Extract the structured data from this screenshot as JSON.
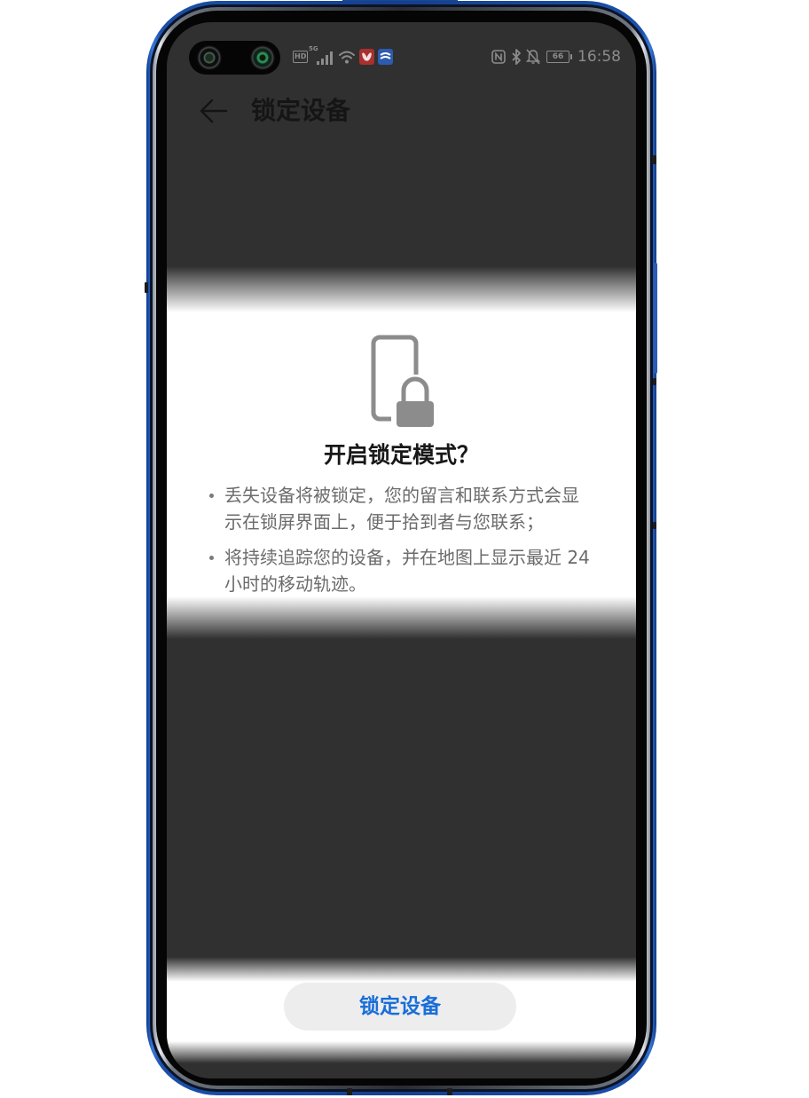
{
  "status_bar": {
    "hd_label": "HD",
    "network_label": "5G",
    "battery_level": "66",
    "time": "16:58",
    "left_icons": [
      "front-camera-icon",
      "depth-camera-icon",
      "signal-icon",
      "wifi-icon",
      "huawei-app-icon",
      "app-notification-icon"
    ],
    "right_icons": [
      "nfc-icon",
      "bluetooth-icon",
      "bell-off-icon",
      "battery-icon"
    ]
  },
  "app_bar": {
    "back_icon": "back-arrow-icon",
    "title": "锁定设备"
  },
  "dialog": {
    "icon": "phone-lock-icon",
    "title": "开启锁定模式？",
    "bullets": [
      "丢失设备将被锁定，您的留言和联系方式会显示在锁屏界面上，便于拾到者与您联系；",
      "将持续追踪您的设备，并在地图上显示最近 24 小时的移动轨迹。"
    ]
  },
  "action": {
    "lock_button_label": "锁定设备"
  },
  "colors": {
    "frame_blue": "#1e4fa6",
    "screen_dim": "#303030",
    "accent_blue": "#1a6ed8",
    "icon_gray": "#8c8c8c",
    "text_secondary": "#6b6b6b"
  }
}
